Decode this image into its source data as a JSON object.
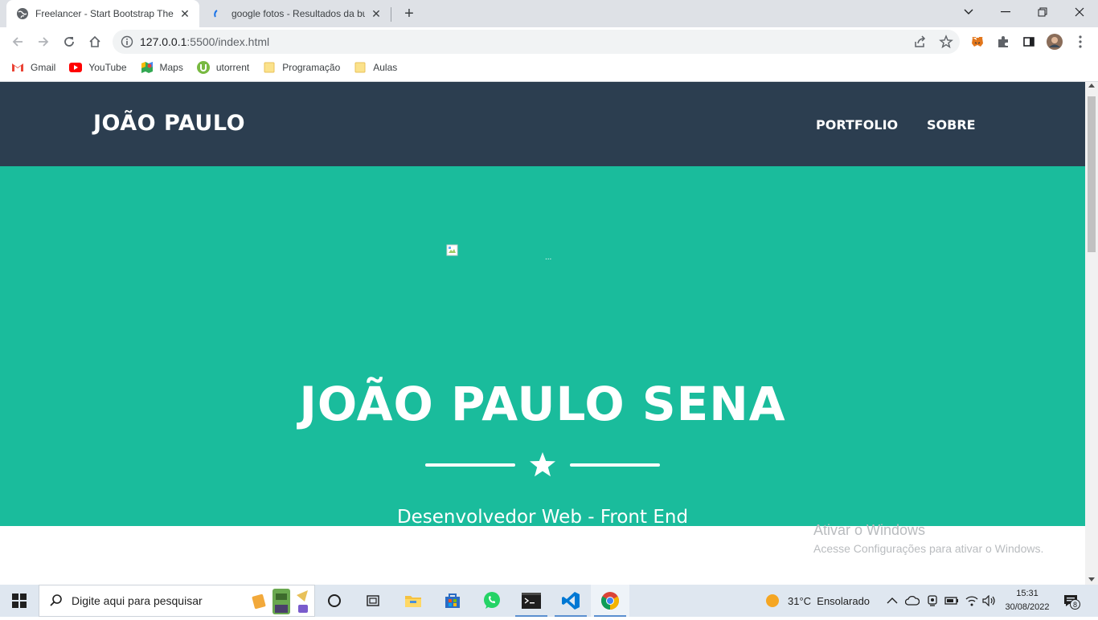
{
  "browser": {
    "tabs": [
      {
        "title": "Freelancer - Start Bootstrap Then",
        "active": true
      },
      {
        "title": "google fotos - Resultados da bus",
        "active": false
      }
    ],
    "url": {
      "host": "127.0.0.1",
      "rest": ":5500/index.html"
    },
    "bookmarks": [
      {
        "label": "Gmail",
        "icon": "gmail-icon"
      },
      {
        "label": "YouTube",
        "icon": "youtube-icon"
      },
      {
        "label": "Maps",
        "icon": "maps-icon"
      },
      {
        "label": "utorrent",
        "icon": "utorrent-icon"
      },
      {
        "label": "Programação",
        "icon": "folder-icon"
      },
      {
        "label": "Aulas",
        "icon": "folder-icon"
      }
    ]
  },
  "site": {
    "brand": "JOÃO PAULO",
    "nav": [
      "PORTFOLIO",
      "SOBRE"
    ],
    "hero_image_alt": "...",
    "hero_title": "JOÃO PAULO SENA",
    "hero_subtitle": "Desenvolvedor Web - Front End",
    "colors": {
      "navbar": "#2c3e50",
      "masthead": "#1abc9c",
      "text": "#ffffff"
    }
  },
  "watermark": {
    "line1": "Ativar o Windows",
    "line2": "Acesse Configurações para ativar o Windows."
  },
  "taskbar": {
    "search_placeholder": "Digite aqui para pesquisar",
    "weather": "31°C  Ensolarado",
    "time": "15:31",
    "date": "30/08/2022",
    "notification_count": "8"
  }
}
